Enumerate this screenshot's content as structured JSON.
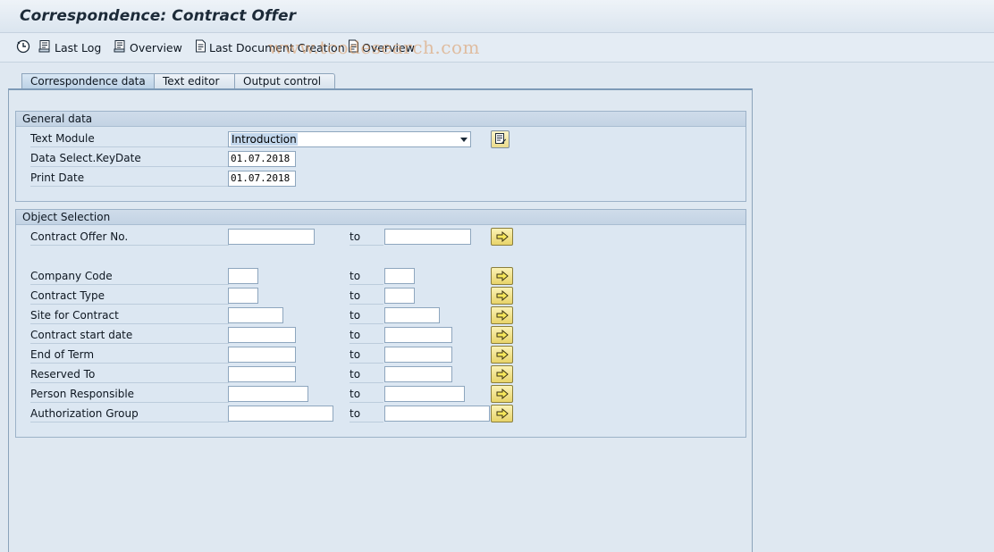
{
  "window": {
    "title": "Correspondence: Contract Offer"
  },
  "toolbar": {
    "items": [
      {
        "label": "",
        "icon": "execute-clock-icon"
      },
      {
        "label": "Last Log",
        "icon": "log-icon"
      },
      {
        "label": "Overview",
        "icon": "overview-icon"
      },
      {
        "label": "Last Document Creation",
        "icon": "document-icon"
      },
      {
        "label": "Overview",
        "icon": "document-icon"
      }
    ],
    "watermark": "www.tcodesearch.com"
  },
  "tabs": [
    {
      "label": "Correspondence data",
      "active": true
    },
    {
      "label": "Text editor",
      "active": false
    },
    {
      "label": "Output control",
      "active": false
    }
  ],
  "general_data": {
    "heading": "General data",
    "text_module": {
      "label": "Text Module",
      "value": "Introduction"
    },
    "key_date": {
      "label": "Data Select.KeyDate",
      "value": "01.07.2018"
    },
    "print_date": {
      "label": "Print Date",
      "value": "01.07.2018"
    }
  },
  "object_selection": {
    "heading": "Object Selection",
    "to_label": "to",
    "rows": [
      {
        "label": "Contract Offer No.",
        "from": "",
        "to": ""
      },
      {
        "label": "Company Code",
        "from": "",
        "to": ""
      },
      {
        "label": "Contract Type",
        "from": "",
        "to": ""
      },
      {
        "label": "Site for Contract",
        "from": "",
        "to": ""
      },
      {
        "label": "Contract start date",
        "from": "",
        "to": ""
      },
      {
        "label": "End of Term",
        "from": "",
        "to": ""
      },
      {
        "label": "Reserved To",
        "from": "",
        "to": ""
      },
      {
        "label": "Person Responsible",
        "from": "",
        "to": ""
      },
      {
        "label": "Authorization Group",
        "from": "",
        "to": ""
      }
    ]
  },
  "colors": {
    "background": "#dfe8f1",
    "button_yellow": "#e8d46a"
  }
}
